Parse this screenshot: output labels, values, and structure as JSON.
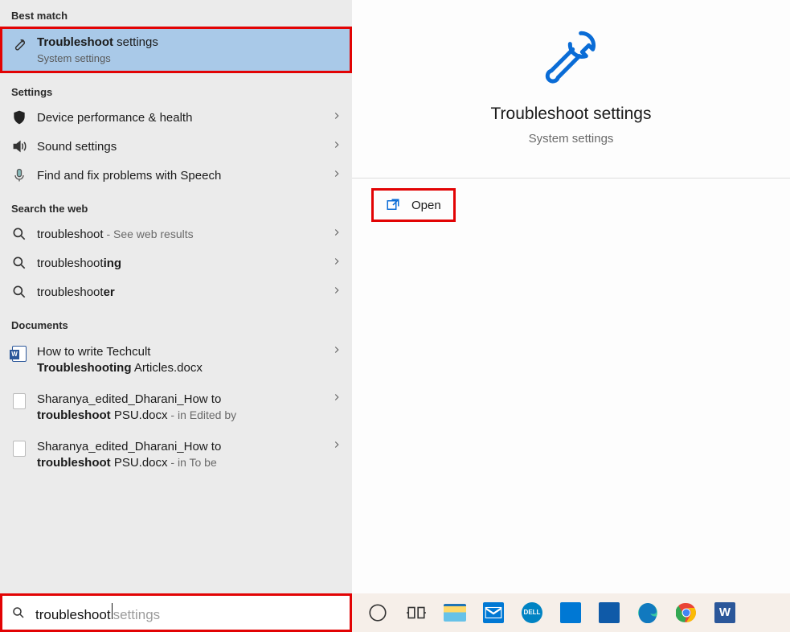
{
  "sections": {
    "best_match": "Best match",
    "settings": "Settings",
    "web": "Search the web",
    "documents": "Documents"
  },
  "best": {
    "title_prefix": "Troubleshoot",
    "title_suffix": " settings",
    "sub": "System settings"
  },
  "settings_items": [
    {
      "label": "Device performance & health",
      "icon": "shield"
    },
    {
      "label": "Sound settings",
      "icon": "speaker"
    },
    {
      "label": "Find and fix problems with Speech",
      "icon": "mic"
    }
  ],
  "web_items": [
    {
      "q": "troubleshoot",
      "suffix": " - See web results"
    },
    {
      "q_pre": "troubleshoot",
      "q_bold": "ing"
    },
    {
      "q_pre": "troubleshoot",
      "q_bold": "er"
    }
  ],
  "docs": [
    {
      "l1": "How to write Techcult ",
      "l2b": "Troubleshooting",
      "l2": " Articles.docx",
      "suffix": ""
    },
    {
      "l1": "Sharanya_edited_Dharani_How to ",
      "l2b": "troubleshoot",
      "l2": " PSU.docx",
      "suffix": " - in Edited by"
    },
    {
      "l1": "Sharanya_edited_Dharani_How to ",
      "l2b": "troubleshoot",
      "l2": " PSU.docx",
      "suffix": " - in To be"
    }
  ],
  "detail": {
    "title": "Troubleshoot settings",
    "sub": "System settings",
    "open": "Open"
  },
  "search": {
    "value": "troubleshoot",
    "autocomplete": " settings"
  }
}
